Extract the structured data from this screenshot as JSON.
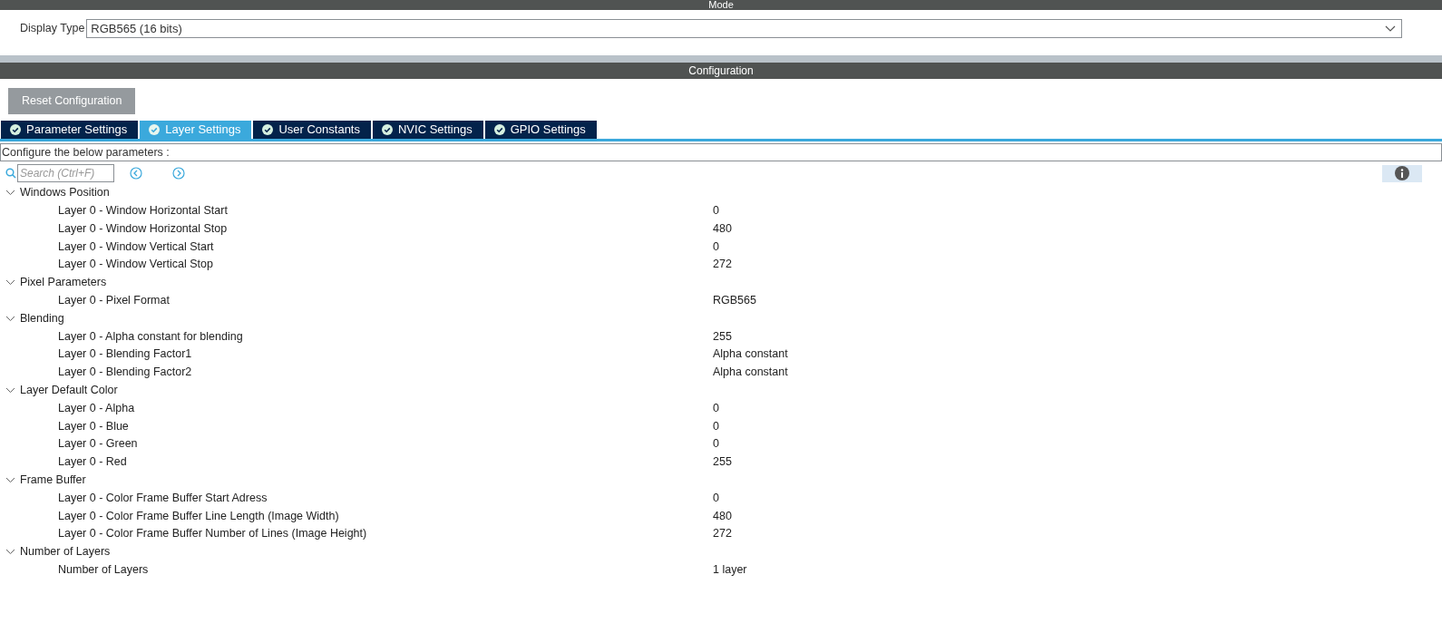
{
  "mode_section": {
    "title": "Mode",
    "field_label": "Display Type",
    "value": "RGB565 (16 bits)"
  },
  "configuration": {
    "title": "Configuration",
    "reset_button": "Reset Configuration",
    "tabs": [
      {
        "label": "Parameter Settings",
        "selected": false
      },
      {
        "label": "Layer Settings",
        "selected": true
      },
      {
        "label": "User Constants",
        "selected": false
      },
      {
        "label": "NVIC Settings",
        "selected": false
      },
      {
        "label": "GPIO Settings",
        "selected": false
      }
    ],
    "instruction": "Configure the below parameters :",
    "search": {
      "placeholder": "Search (Ctrl+F)"
    },
    "parameters": [
      {
        "label": "Windows Position",
        "expanded": true,
        "children": [
          {
            "label": "Layer 0 - Window Horizontal Start",
            "value": "0"
          },
          {
            "label": "Layer 0 - Window Horizontal Stop",
            "value": "480"
          },
          {
            "label": "Layer 0 - Window Vertical Start",
            "value": "0"
          },
          {
            "label": "Layer 0 - Window Vertical Stop",
            "value": "272"
          }
        ]
      },
      {
        "label": "Pixel Parameters",
        "expanded": true,
        "children": [
          {
            "label": "Layer 0 - Pixel Format",
            "value": "RGB565"
          }
        ]
      },
      {
        "label": "Blending",
        "expanded": true,
        "children": [
          {
            "label": "Layer 0 - Alpha constant for blending",
            "value": "255"
          },
          {
            "label": "Layer 0 - Blending Factor1",
            "value": "Alpha constant"
          },
          {
            "label": "Layer 0 - Blending Factor2",
            "value": "Alpha constant"
          }
        ]
      },
      {
        "label": "Layer Default Color",
        "expanded": true,
        "children": [
          {
            "label": "Layer 0 - Alpha",
            "value": "0"
          },
          {
            "label": "Layer 0 - Blue",
            "value": "0"
          },
          {
            "label": "Layer 0 - Green",
            "value": "0"
          },
          {
            "label": "Layer 0 - Red",
            "value": "255"
          }
        ]
      },
      {
        "label": "Frame Buffer",
        "expanded": true,
        "children": [
          {
            "label": "Layer 0 - Color Frame Buffer Start Adress",
            "value": "0"
          },
          {
            "label": "Layer 0 - Color Frame Buffer Line Length (Image Width)",
            "value": "480"
          },
          {
            "label": "Layer 0 - Color Frame Buffer Number of Lines (Image Height)",
            "value": "272"
          }
        ]
      },
      {
        "label": "Number of Layers",
        "expanded": true,
        "children": [
          {
            "label": "Number of Layers",
            "value": "1 layer"
          }
        ]
      }
    ]
  }
}
